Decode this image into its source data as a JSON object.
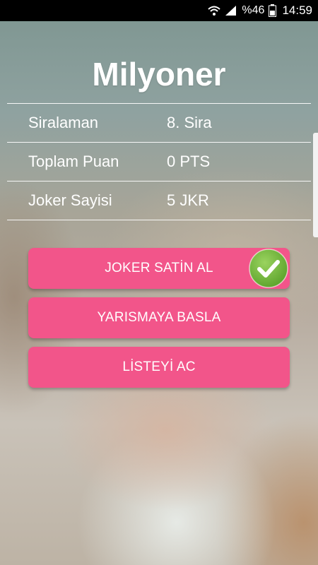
{
  "status_bar": {
    "battery_percent": "%46",
    "time": "14:59",
    "icons": [
      "wifi-icon",
      "signal-icon",
      "battery-icon"
    ]
  },
  "title": "Milyoner",
  "stats": [
    {
      "label": "Siralaman",
      "value": "8. Sira"
    },
    {
      "label": "Toplam Puan",
      "value": "0 PTS"
    },
    {
      "label": "Joker Sayisi",
      "value": "5 JKR"
    }
  ],
  "buttons": {
    "joker": "JOKER SATİN AL",
    "start": "YARISMAYA BASLA",
    "list": "LİSTEYİ AC"
  },
  "colors": {
    "button": "#f2558a",
    "check": "#7ac143"
  }
}
